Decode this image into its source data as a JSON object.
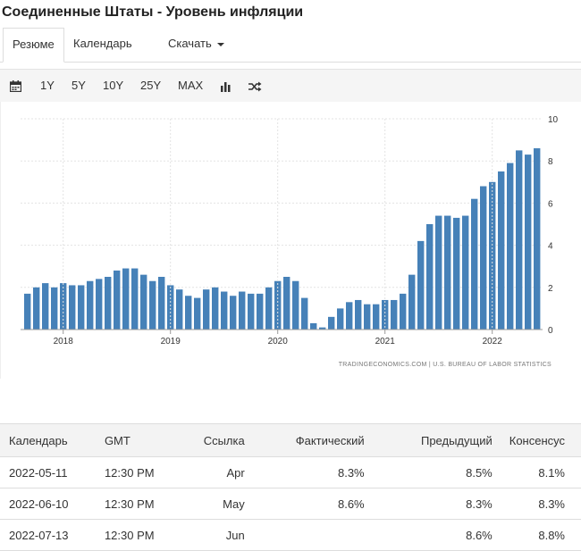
{
  "page": {
    "title": "Соединенные Штаты - Уровень инфляции"
  },
  "tabs": [
    {
      "label": "Резюме"
    },
    {
      "label": "Календарь"
    },
    {
      "label": "Скачать"
    }
  ],
  "toolbar": {
    "icons": [
      "calendar-icon",
      "bar-chart-icon",
      "shuffle-icon"
    ],
    "ranges": [
      "1Y",
      "5Y",
      "10Y",
      "25Y",
      "MAX"
    ]
  },
  "chart_data": {
    "type": "bar",
    "color": "#4681b8",
    "x_ticks": [
      "2018",
      "2019",
      "2020",
      "2021",
      "2022"
    ],
    "ylim": [
      0,
      10
    ],
    "y_ticks": [
      "0",
      "2",
      "4",
      "6",
      "8",
      "10"
    ],
    "grid": true,
    "source": "TRADINGECONOMICS.COM  |  U.S. BUREAU OF LABOR STATISTICS",
    "categories": [
      "2017-09",
      "2017-10",
      "2017-11",
      "2017-12",
      "2018-01",
      "2018-02",
      "2018-03",
      "2018-04",
      "2018-05",
      "2018-06",
      "2018-07",
      "2018-08",
      "2018-09",
      "2018-10",
      "2018-11",
      "2018-12",
      "2019-01",
      "2019-02",
      "2019-03",
      "2019-04",
      "2019-05",
      "2019-06",
      "2019-07",
      "2019-08",
      "2019-09",
      "2019-10",
      "2019-11",
      "2019-12",
      "2020-01",
      "2020-02",
      "2020-03",
      "2020-04",
      "2020-05",
      "2020-06",
      "2020-07",
      "2020-08",
      "2020-09",
      "2020-10",
      "2020-11",
      "2020-12",
      "2021-01",
      "2021-02",
      "2021-03",
      "2021-04",
      "2021-05",
      "2021-06",
      "2021-07",
      "2021-08",
      "2021-09",
      "2021-10",
      "2021-11",
      "2021-12",
      "2022-01",
      "2022-02",
      "2022-03",
      "2022-04",
      "2022-05"
    ],
    "values": [
      1.7,
      2.0,
      2.2,
      2.0,
      2.2,
      2.1,
      2.1,
      2.3,
      2.4,
      2.5,
      2.8,
      2.9,
      2.9,
      2.6,
      2.3,
      2.5,
      2.1,
      1.9,
      1.6,
      1.5,
      1.9,
      2.0,
      1.8,
      1.6,
      1.8,
      1.7,
      1.7,
      2.0,
      2.3,
      2.5,
      2.3,
      1.5,
      0.3,
      0.1,
      0.6,
      1.0,
      1.3,
      1.4,
      1.2,
      1.2,
      1.4,
      1.4,
      1.7,
      2.6,
      4.2,
      5.0,
      5.4,
      5.4,
      5.3,
      5.4,
      6.2,
      6.8,
      7.0,
      7.5,
      7.9,
      8.5,
      8.3,
      8.6
    ]
  },
  "table": {
    "headers": [
      "Календарь",
      "GMT",
      "Ссылка",
      "Фактический",
      "Предыдущий",
      "Консенсус"
    ],
    "rows": [
      [
        "2022-05-11",
        "12:30 PM",
        "Apr",
        "8.3%",
        "8.5%",
        "8.1%"
      ],
      [
        "2022-06-10",
        "12:30 PM",
        "May",
        "8.6%",
        "8.3%",
        "8.3%"
      ],
      [
        "2022-07-13",
        "12:30 PM",
        "Jun",
        "",
        "8.6%",
        "8.8%"
      ]
    ]
  }
}
